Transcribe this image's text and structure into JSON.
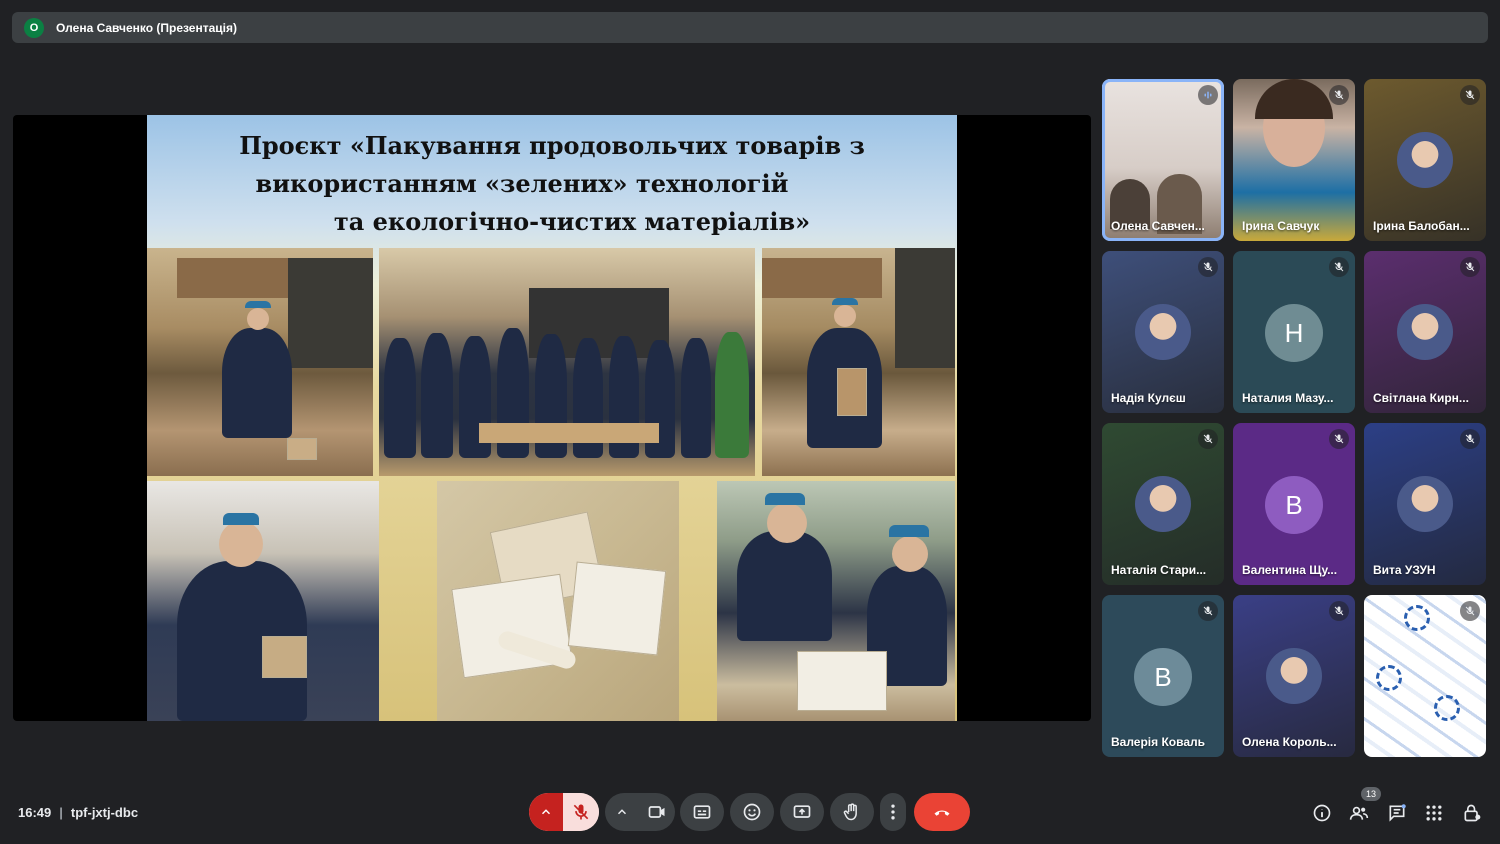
{
  "topbar": {
    "presenter_initial": "O",
    "presenter_label": "Олена Савченко (Презентація)"
  },
  "slide": {
    "title_lines": [
      "Проєкт «Пакування продовольчих товарів з",
      "використанням «зелених» технологій",
      "та екологічно-чистих матеріалів»"
    ]
  },
  "participants": [
    {
      "name": "Олена Савчен...",
      "type": "video",
      "badge": "speaking-icon",
      "active": true
    },
    {
      "name": "Ірина Савчук",
      "type": "video",
      "badge": "mic-off-icon"
    },
    {
      "name": "Ірина Балобан...",
      "type": "photo",
      "badge": "mic-off-icon",
      "bg": "#6d5a2e"
    },
    {
      "name": "Надія Кулєш",
      "type": "photo",
      "badge": "mic-off-icon",
      "bg": "#3e4f7a"
    },
    {
      "name": "Наталия Мазу...",
      "type": "letter",
      "letter": "Н",
      "badge": "mic-off-icon",
      "bg": "#2b4a56",
      "circle": "#6f8c93"
    },
    {
      "name": "Світлана Кирн...",
      "type": "photo",
      "badge": "mic-off-icon",
      "bg": "#5b2e6e"
    },
    {
      "name": "Наталія Стари...",
      "type": "photo",
      "badge": "mic-off-icon",
      "bg": "#2f4a32"
    },
    {
      "name": "Валентина Щу...",
      "type": "letter",
      "letter": "В",
      "badge": "mic-off-icon",
      "bg": "#5b2a86",
      "circle": "#8e5cc0"
    },
    {
      "name": "Вита УЗУН",
      "type": "photo",
      "badge": "mic-off-icon",
      "bg": "#2c3f86"
    },
    {
      "name": "Валерія Коваль",
      "type": "letter",
      "letter": "В",
      "badge": "mic-off-icon",
      "bg": "#2d4a5a",
      "circle": "#6d8b99"
    },
    {
      "name": "Олена Король...",
      "type": "photo",
      "badge": "mic-off-icon",
      "bg": "#3a3f86"
    },
    {
      "name": "",
      "type": "pattern",
      "badge": "mic-off-icon"
    }
  ],
  "bottom": {
    "time": "16:49",
    "separator": "|",
    "meeting_code": "tpf-jxtj-dbc",
    "participants_count": "13"
  },
  "colors": {
    "hangup": "#ea4335",
    "mic_off_bg": "#f9dedc",
    "accent": "#8ab4f8"
  }
}
